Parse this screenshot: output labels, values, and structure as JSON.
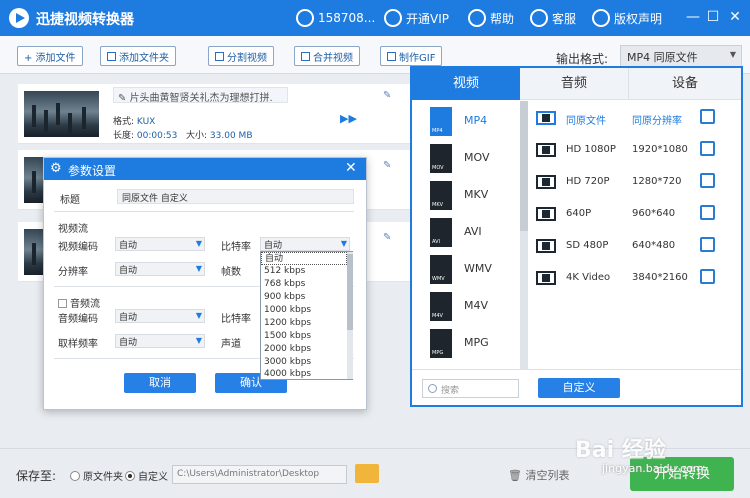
{
  "app": {
    "title": "迅捷视频转换器"
  },
  "titlebar": {
    "user": "158708...",
    "vip": "开通VIP",
    "help": "帮助",
    "service": "客服",
    "copyright": "版权声明",
    "minimize": "—",
    "maximize": "☐",
    "close": "✕"
  },
  "toolbar": {
    "add_file": "+ 添加文件",
    "add_folder": "添加文件夹",
    "split": "分割视频",
    "merge": "合并视频",
    "gif": "制作GIF",
    "format_label": "输出格式:",
    "format_value": "MP4  同原文件"
  },
  "file": {
    "name": "片头曲黄智贤关礼杰为理想打拼.",
    "format_label": "格式:",
    "format": "KUX",
    "dur_label": "长度:",
    "duration": "00:00:53",
    "size_label": "大小:",
    "size": "33.00 MB",
    "arrow": "▶▶"
  },
  "dialog": {
    "title": "参数设置",
    "close": "✕",
    "title_label": "标题",
    "title_value": "同原文件 自定义",
    "video_section": "视频流",
    "video_codec_label": "视频编码",
    "video_codec": "自动",
    "bitrate_label": "比特率",
    "bitrate": "自动",
    "resolution_label": "分辨率",
    "resolution": "自动",
    "fps_label": "帧数",
    "audio_section": "音频流",
    "audio_codec_label": "音频编码",
    "audio_codec": "自动",
    "audio_bitrate_label": "比特率",
    "sample_label": "取样频率",
    "sample": "自动",
    "channel_label": "声道",
    "cancel": "取消",
    "ok": "确认",
    "bitrate_options": [
      "自动",
      "512 kbps",
      "768 kbps",
      "900 kbps",
      "1000 kbps",
      "1200 kbps",
      "1500 kbps",
      "2000 kbps",
      "3000 kbps",
      "4000 kbps"
    ]
  },
  "format_panel": {
    "tabs": [
      "视频",
      "音频",
      "设备"
    ],
    "video_formats": [
      "MP4",
      "MOV",
      "MKV",
      "AVI",
      "WMV",
      "M4V",
      "MPG"
    ],
    "qualities": [
      {
        "name": "同原文件",
        "res": "同原分辨率"
      },
      {
        "name": "HD 1080P",
        "res": "1920*1080"
      },
      {
        "name": "HD 720P",
        "res": "1280*720"
      },
      {
        "name": "640P",
        "res": "960*640"
      },
      {
        "name": "SD 480P",
        "res": "640*480"
      },
      {
        "name": "4K Video",
        "res": "3840*2160"
      }
    ],
    "search_placeholder": "搜索",
    "custom": "自定义"
  },
  "bottom": {
    "save_label": "保存至:",
    "opt_source": "原文件夹",
    "opt_custom": "自定义",
    "path": "C:\\Users\\Administrator\\Desktop",
    "clear": "清空列表",
    "convert": "开始转换"
  },
  "watermark": {
    "main": "Bai 经验",
    "sub": "jingyan.baidu.com"
  },
  "colors": {
    "primary": "#1e7be0",
    "convert": "#3fb34f"
  }
}
